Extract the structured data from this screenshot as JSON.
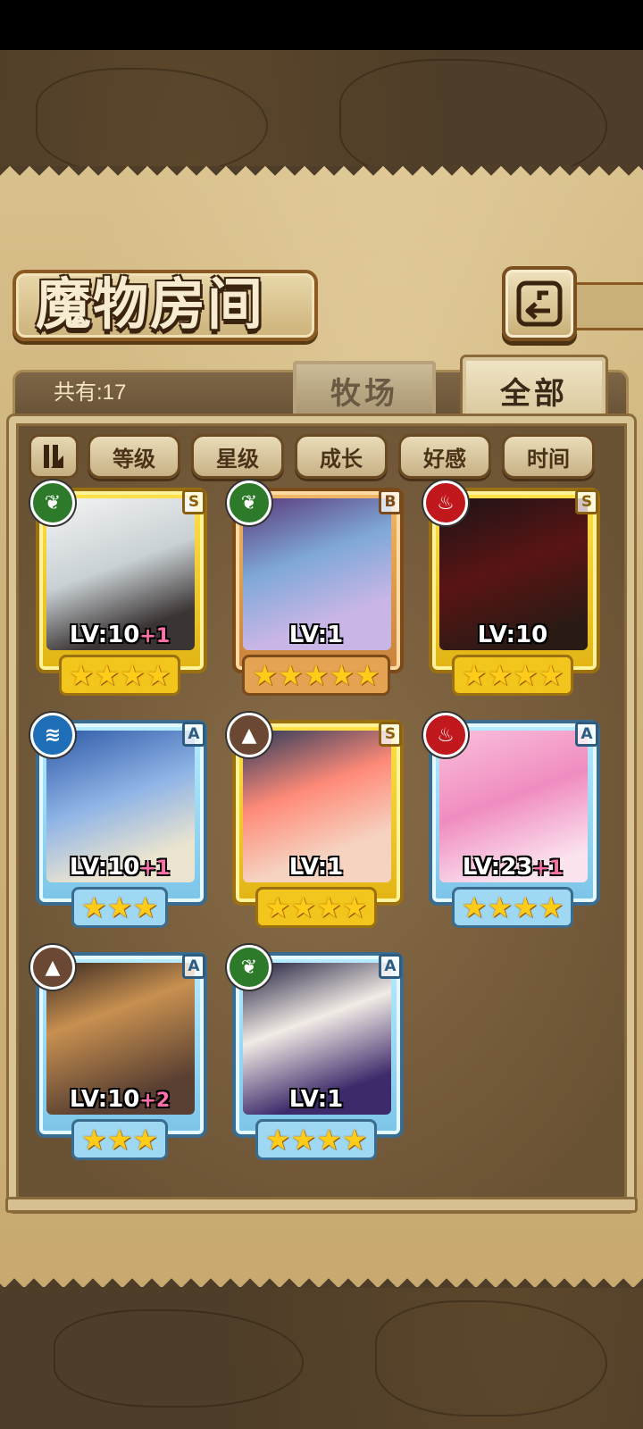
{
  "header": {
    "title": "魔物房间"
  },
  "summary": {
    "count_label": "共有:17"
  },
  "tabs": [
    {
      "label": "牧场",
      "active": false
    },
    {
      "label": "全部",
      "active": true
    }
  ],
  "sort": {
    "toggle_icon": "sort-order-icon",
    "buttons": [
      "等级",
      "星级",
      "成长",
      "好感",
      "时间"
    ]
  },
  "colors": {
    "gold_frame": "#ffe14a",
    "bronze_frame": "#f0b868",
    "blue_frame": "#b7ecff",
    "plus_text": "#ff6fa8",
    "nature": "#2d7a2a",
    "fire": "#c0181c",
    "water": "#1f6fb8",
    "earth": "#6a4834"
  },
  "monsters": [
    {
      "element": "nature",
      "rank": "S",
      "frame": "gold",
      "level": "LV:10",
      "plus": "+1",
      "stars": 4
    },
    {
      "element": "nature",
      "rank": "B",
      "frame": "bronze",
      "level": "LV:1",
      "plus": "",
      "stars": 5
    },
    {
      "element": "fire",
      "rank": "S",
      "frame": "gold",
      "level": "LV:10",
      "plus": "",
      "stars": 4
    },
    {
      "element": "water",
      "rank": "A",
      "frame": "blue",
      "level": "LV:10",
      "plus": "+1",
      "stars": 3
    },
    {
      "element": "earth",
      "rank": "S",
      "frame": "gold",
      "level": "LV:1",
      "plus": "",
      "stars": 4
    },
    {
      "element": "fire",
      "rank": "A",
      "frame": "blue",
      "level": "LV:23",
      "plus": "+1",
      "stars": 4
    },
    {
      "element": "earth",
      "rank": "A",
      "frame": "blue",
      "level": "LV:10",
      "plus": "+2",
      "stars": 3
    },
    {
      "element": "nature",
      "rank": "A",
      "frame": "blue",
      "level": "LV:1",
      "plus": "",
      "stars": 4
    }
  ]
}
